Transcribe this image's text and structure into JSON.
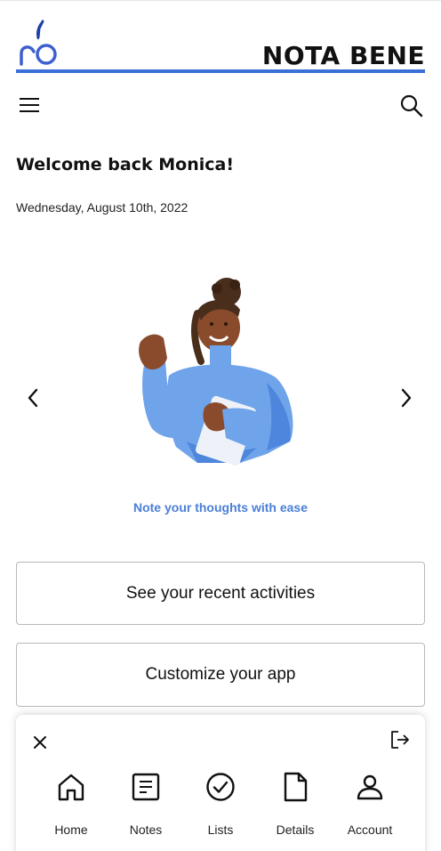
{
  "header": {
    "brand": "NOTA BENE",
    "logo_icon": "pen-nib-logo-icon",
    "accent_color": "#3b6fd8"
  },
  "toolbar": {
    "menu_icon": "hamburger-menu-icon",
    "search_icon": "search-icon"
  },
  "greeting": {
    "title": "Welcome back Monica!",
    "date": "Wednesday, August 10th, 2022"
  },
  "carousel": {
    "prev_icon": "chevron-left-icon",
    "next_icon": "chevron-right-icon",
    "caption": "Note your thoughts with ease",
    "caption_color": "#4a7fd6"
  },
  "actions": [
    {
      "label": "See your recent activities"
    },
    {
      "label": "Customize your app"
    }
  ],
  "bottom_nav": {
    "close_icon": "close-icon",
    "logout_icon": "logout-icon",
    "items": [
      {
        "label": "Home",
        "icon": "home-icon"
      },
      {
        "label": "Notes",
        "icon": "notes-icon"
      },
      {
        "label": "Lists",
        "icon": "check-circle-icon"
      },
      {
        "label": "Details",
        "icon": "document-icon"
      },
      {
        "label": "Account",
        "icon": "user-icon"
      }
    ]
  }
}
